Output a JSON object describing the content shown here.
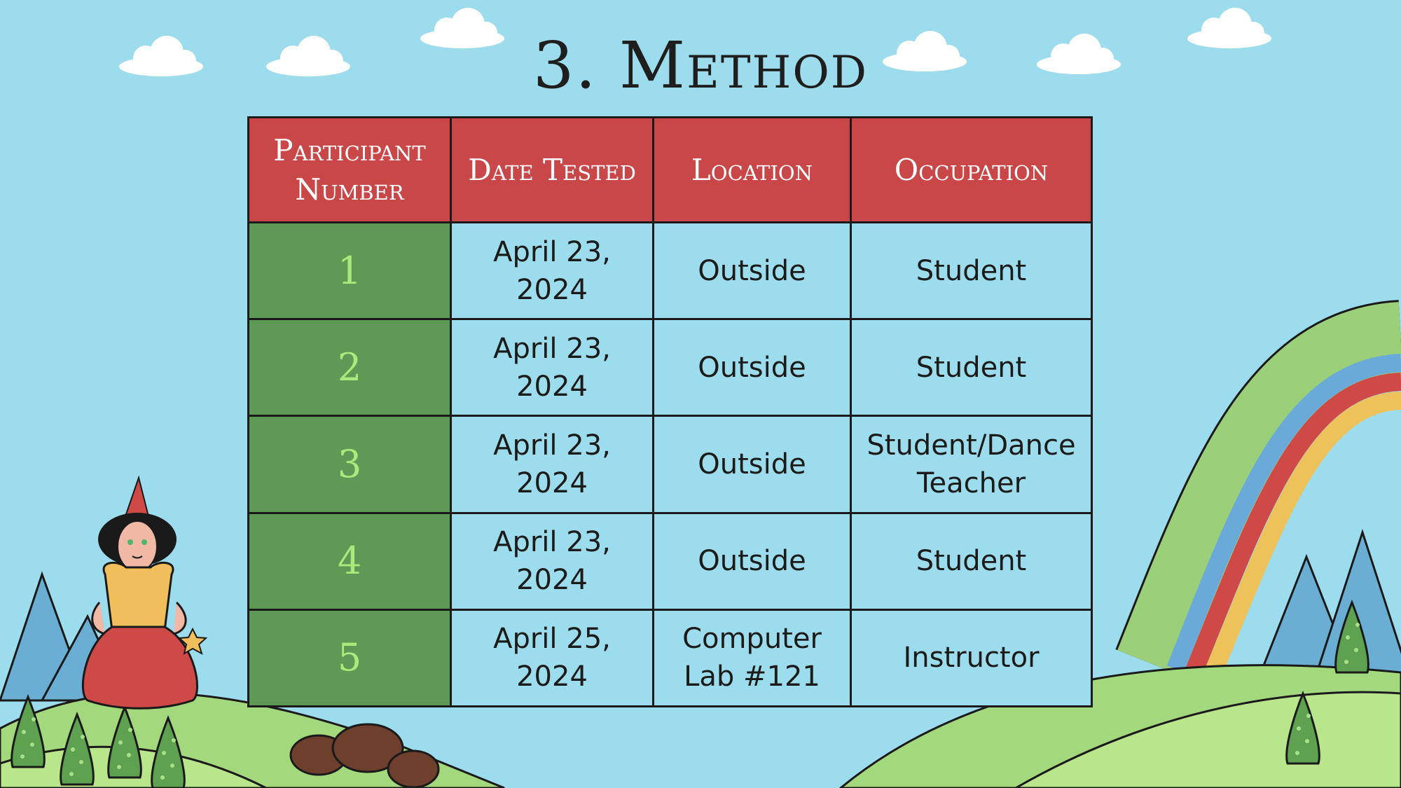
{
  "slide": {
    "title": "3. Method"
  },
  "table": {
    "headers": [
      "Participant Number",
      "Date Tested",
      "Location",
      "Occupation"
    ],
    "rows": [
      {
        "number": "1",
        "date": "April 23, 2024",
        "location": "Outside",
        "occupation": "Student"
      },
      {
        "number": "2",
        "date": "April 23, 2024",
        "location": "Outside",
        "occupation": "Student"
      },
      {
        "number": "3",
        "date": "April 23, 2024",
        "location": "Outside",
        "occupation": "Student/Dance Teacher"
      },
      {
        "number": "4",
        "date": "April 23, 2024",
        "location": "Outside",
        "occupation": "Student"
      },
      {
        "number": "5",
        "date": "April 25, 2024",
        "location": "Computer Lab #121",
        "occupation": "Instructor"
      }
    ]
  },
  "colors": {
    "sky": "#9ddcec",
    "header_red": "#c94748",
    "number_green": "#5e9a55",
    "number_text": "#a8ea7e",
    "hill_green": "#a3d87c",
    "rainbow": [
      "#9ccf7a",
      "#6aaad8",
      "#cf4a46",
      "#eec25a"
    ]
  },
  "illustration": {
    "icons": [
      "cloud-icon",
      "mountain-icon",
      "pine-tree-icon",
      "rainbow-icon",
      "princess-icon",
      "star-wand-icon",
      "rock-icon",
      "hill-icon"
    ]
  }
}
